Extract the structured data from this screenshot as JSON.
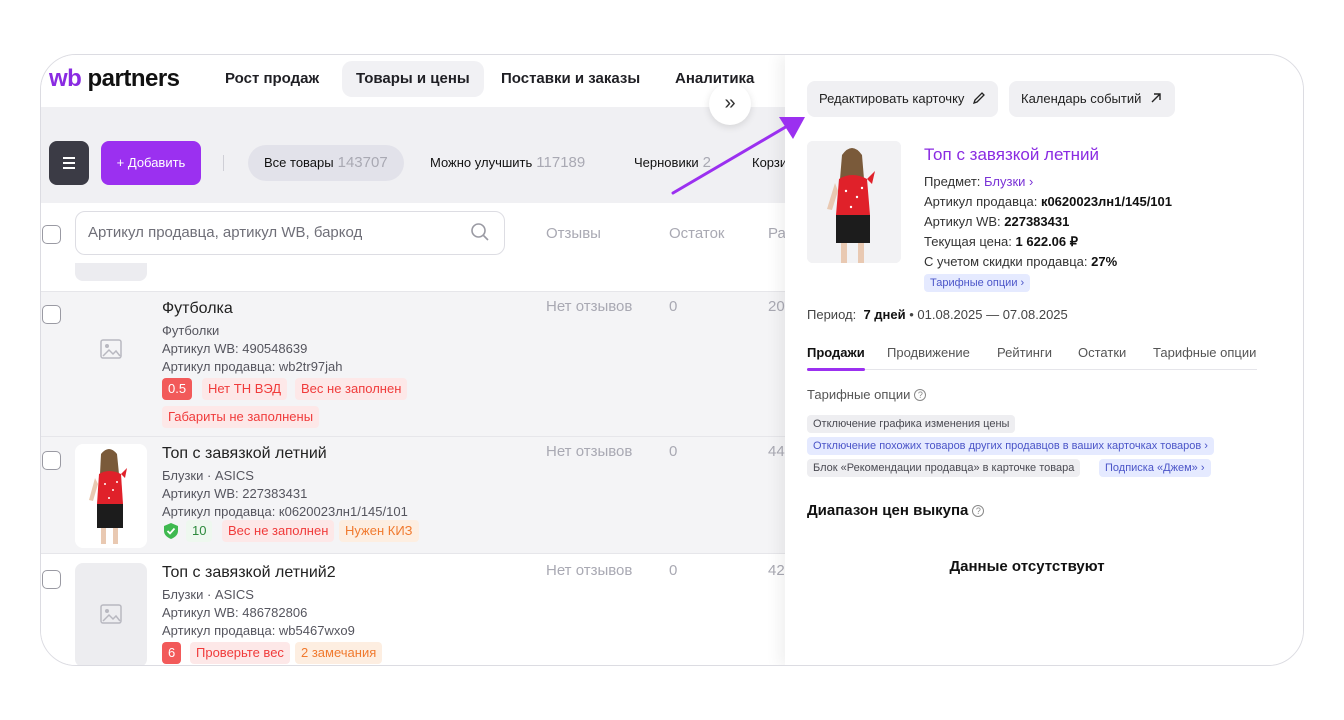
{
  "brand": {
    "logo_wb": "wb",
    "logo_rest": " partners"
  },
  "nav": {
    "items": [
      "Рост продаж",
      "Товары и цены",
      "Поставки и заказы",
      "Аналитика"
    ],
    "collapse_icon": "»"
  },
  "toolbar": {
    "add_label": "+ Добавить",
    "filters": [
      {
        "label": "Все товары",
        "count": "143707"
      },
      {
        "label": "Можно улучшить",
        "count": "117189"
      },
      {
        "label": "Черновики",
        "count": "2"
      },
      {
        "label": "Корзи",
        "count": ""
      }
    ]
  },
  "list": {
    "search_placeholder": "Артикул продавца, артикул WB, баркод",
    "columns": [
      "Отзывы",
      "Остаток",
      "Ра"
    ],
    "rows": [
      {
        "title": "Футболка",
        "category": "Футболки",
        "wb_article": "Артикул WB: 490548639",
        "seller_article": "Артикул продавца: wb2tr97jah",
        "reviews": "Нет отзывов",
        "stock": "0",
        "extra": "20",
        "score": "0.5",
        "tags": [
          "Нет ТН ВЭД",
          "Вес не заполнен",
          "Габариты не заполнены"
        ]
      },
      {
        "title": "Топ с завязкой летний",
        "category": "Блузки · ASICS",
        "wb_article": "Артикул WB: 227383431",
        "seller_article": "Артикул продавца: к0620023лн1/145/101",
        "reviews": "Нет отзывов",
        "stock": "0",
        "extra": "44",
        "score": "10",
        "tags": [
          "Вес не заполнен",
          "Нужен КИЗ"
        ]
      },
      {
        "title": "Топ с завязкой летний2",
        "category": "Блузки · ASICS",
        "wb_article": "Артикул WB: 486782806",
        "seller_article": "Артикул продавца: wb5467wxo9",
        "reviews": "Нет отзывов",
        "stock": "0",
        "extra": "42",
        "score": "6",
        "tags": [
          "Проверьте вес",
          "2 замечания"
        ]
      }
    ]
  },
  "panel": {
    "edit_label": "Редактировать карточку",
    "calendar_label": "Календарь событий",
    "title": "Топ с завязкой летний",
    "subject_label": "Предмет:",
    "subject_value": "Блузки",
    "seller_article_label": "Артикул продавца:",
    "seller_article_value": "к0620023лн1/145/101",
    "wb_article_label": "Артикул WB:",
    "wb_article_value": "227383431",
    "price_label": "Текущая цена:",
    "price_value": "1 622.06 ₽",
    "discount_label": "С учетом скидки продавца:",
    "discount_value": "27%",
    "tariff_chip": "Тарифные опции",
    "period_label": "Период:",
    "period_days": "7 дней",
    "period_range": "01.08.2025 — 07.08.2025",
    "tabs": [
      "Продажи",
      "Продвижение",
      "Рейтинги",
      "Остатки",
      "Тарифные опции"
    ],
    "tariff_section": "Тарифные опции",
    "options": [
      "Отключение графика изменения цены",
      "Отключение похожих товаров других продавцов в ваших карточках товаров",
      "Блок «Рекомендации продавца» в карточке товара",
      "Подписка «Джем»"
    ],
    "range_title": "Диапазон цен выкупа",
    "empty_text": "Данные отсутствуют"
  },
  "colors": {
    "accent": "#9b30f0",
    "brand": "#8a2be2",
    "error": "#f03b3b",
    "warning": "#f07a2f"
  }
}
